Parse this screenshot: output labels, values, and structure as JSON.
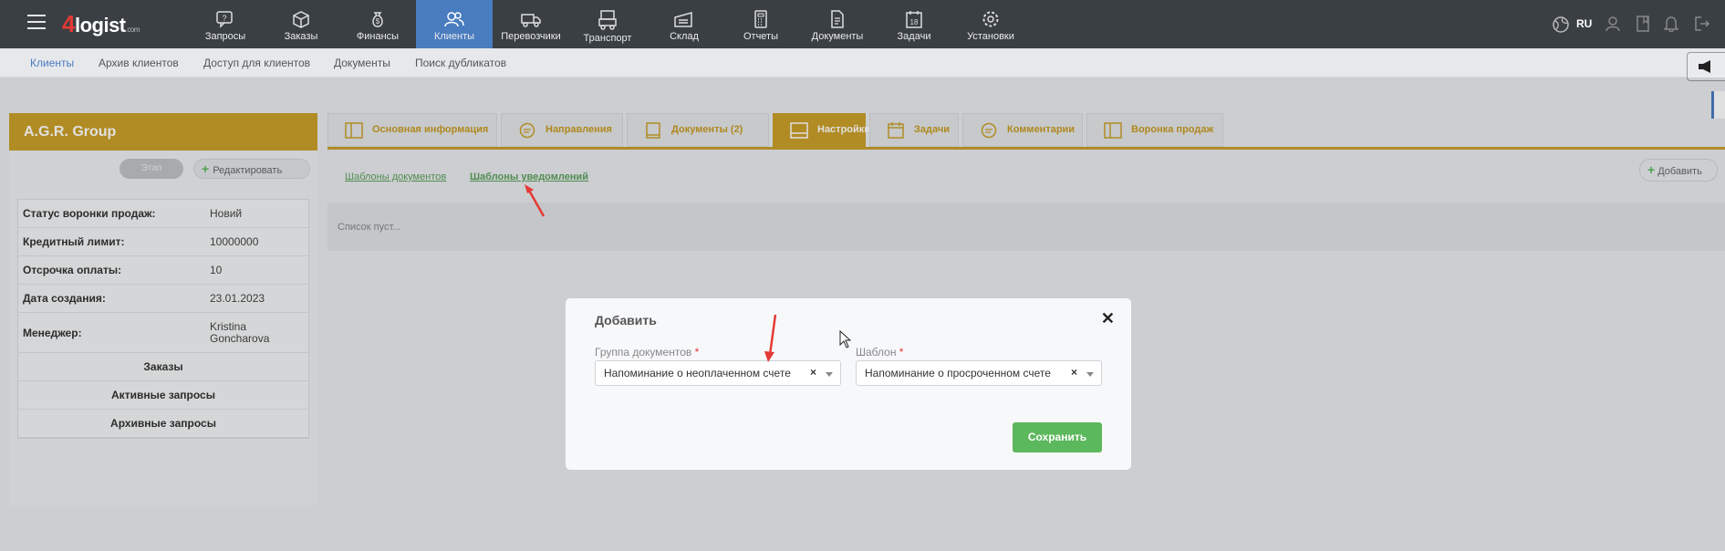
{
  "app": {
    "logo": "4logist",
    "logo_suffix": ".com"
  },
  "topnav": {
    "items": [
      {
        "label": "Запросы",
        "icon": "requests-icon"
      },
      {
        "label": "Заказы",
        "icon": "orders-icon"
      },
      {
        "label": "Финансы",
        "icon": "finance-icon"
      },
      {
        "label": "Клиенты",
        "icon": "clients-icon",
        "active": true
      },
      {
        "label": "Перевозчики",
        "icon": "truck-icon"
      },
      {
        "label": "Транспорт",
        "icon": "transport-icon"
      },
      {
        "label": "Склад",
        "icon": "warehouse-icon"
      },
      {
        "label": "Отчеты",
        "icon": "calculator-icon"
      },
      {
        "label": "Документы",
        "icon": "document-icon"
      },
      {
        "label": "Задачи",
        "icon": "calendar-icon"
      },
      {
        "label": "Установки",
        "icon": "gear-icon"
      }
    ],
    "lang": "RU"
  },
  "subnav": {
    "items": [
      "Клиенты",
      "Архив клиентов",
      "Доступ для клиентов",
      "Документы",
      "Поиск дубликатов"
    ]
  },
  "client": {
    "name": "A.G.R. Group",
    "stage_label": "Этап",
    "edit_label": "Редактировать",
    "fields": [
      {
        "key": "Статус воронки продаж:",
        "value": "Новий"
      },
      {
        "key": "Кредитный лимит:",
        "value": "10000000"
      },
      {
        "key": "Отсрочка оплаты:",
        "value": "10"
      },
      {
        "key": "Дата создания:",
        "value": "23.01.2023"
      },
      {
        "key": "Менеджер:",
        "value": "Kristina Goncharova"
      }
    ],
    "sections": [
      "Заказы",
      "Активные запросы",
      "Архивные запросы"
    ]
  },
  "tabs": [
    {
      "label": "Основная информация"
    },
    {
      "label": "Направления"
    },
    {
      "label": "Документы  (2)"
    },
    {
      "label": "Настройки",
      "active": true
    },
    {
      "label": "Задачи"
    },
    {
      "label": "Комментарии"
    },
    {
      "label": "Воронка продаж"
    }
  ],
  "settings": {
    "links": [
      "Шаблоны документов",
      "Шаблоны уведомлений"
    ],
    "add_label": "Добавить",
    "empty_text": "Список пуст..."
  },
  "modal": {
    "title": "Добавить",
    "group_label": "Группа документов",
    "group_value": "Напоминание о неоплаченном счете",
    "template_label": "Шаблон",
    "template_value": "Напоминание о просроченном счете",
    "required_mark": "*",
    "save_label": "Сохранить",
    "close_glyph": "✕",
    "clear_glyph": "×"
  },
  "colors": {
    "accent": "#caa02a",
    "nav": "#3a3f44",
    "active_nav": "#4a7cc0",
    "save": "#5cb85c",
    "arrow": "#e53935"
  }
}
